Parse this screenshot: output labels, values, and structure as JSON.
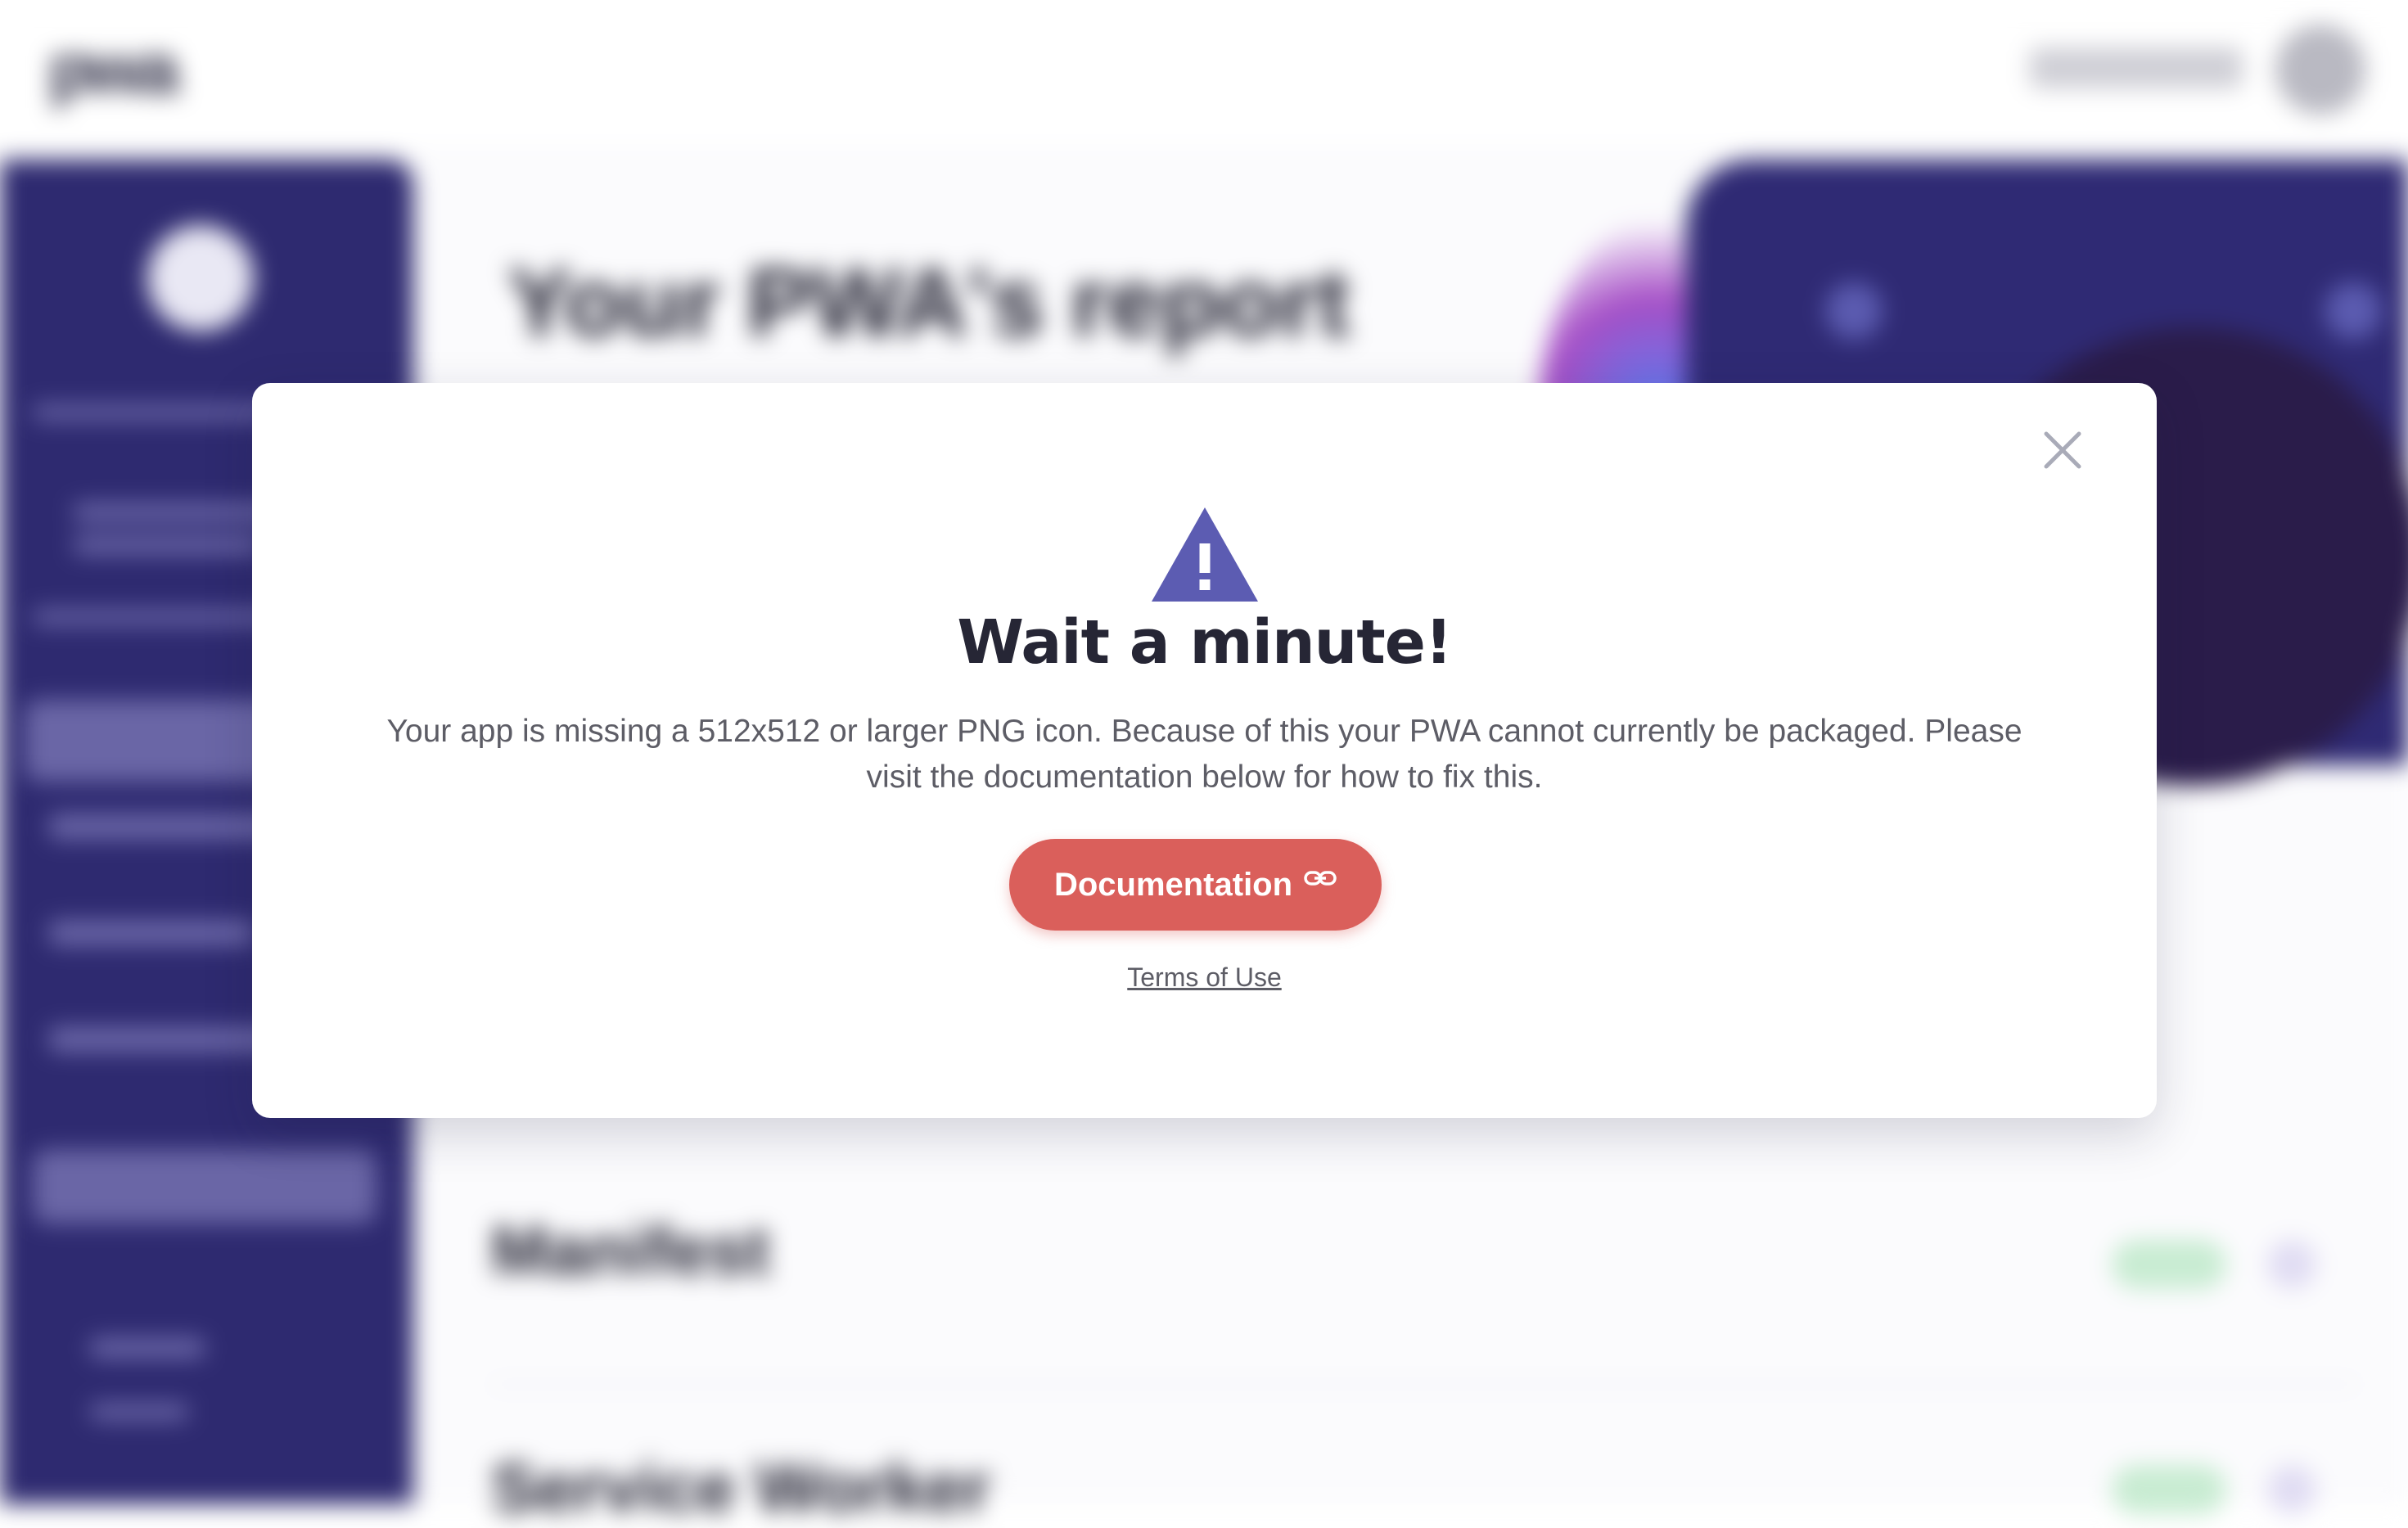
{
  "background": {
    "logo_text": "",
    "page_title": "Your PWA's report",
    "sections": [
      "Manifest",
      "Service Worker"
    ]
  },
  "modal": {
    "title": "Wait a minute!",
    "body": "Your app is missing a 512x512 or larger PNG icon. Because of this your PWA cannot currently be packaged. Please visit the documentation below for how to fix this.",
    "primary_button": "Documentation",
    "secondary_link": "Terms of Use",
    "icons": {
      "warning": "warning-triangle-icon",
      "close": "close-icon",
      "link": "link-icon"
    },
    "colors": {
      "accent": "#da5f5b",
      "warning": "#5c5cb2",
      "title": "#262635"
    }
  }
}
